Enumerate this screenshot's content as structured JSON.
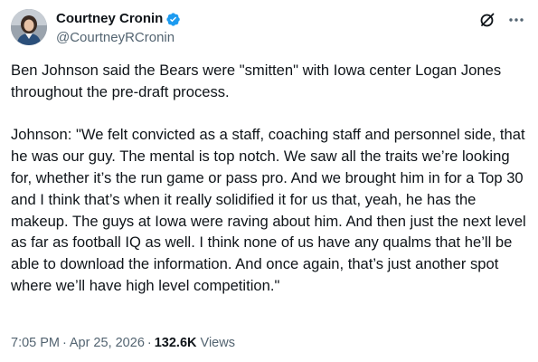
{
  "author": {
    "display_name": "Courtney Cronin",
    "handle": "@CourtneyRCronin",
    "verified": true,
    "verified_badge_color": "#1d9bf0",
    "avatar_icon": "profile-photo"
  },
  "header_actions": {
    "grok_icon": "slashed-circle-icon",
    "more_icon": "more-dots-icon"
  },
  "post": {
    "paragraphs": [
      "Ben Johnson said the Bears were \"smitten\" with Iowa center Logan Jones throughout the pre-draft process.",
      "Johnson: \"We felt convicted as a staff, coaching staff and personnel side, that he was our guy. The mental is top notch. We saw all the traits we’re looking for, whether it’s the run game or pass pro. And we brought him in for a Top 30 and I think that’s when it really solidified it for us that, yeah, he has the makeup. The guys at Iowa were raving about him. And then just the next level as far as football IQ as well. I think none of us have any qualms that he’ll be able to download the information. And once again, that’s just another spot where we’ll have high level competition.\""
    ]
  },
  "meta": {
    "time": "7:05 PM",
    "date": "Apr 25, 2026",
    "separator": "·",
    "views_count": "132.6K",
    "views_label": "Views"
  },
  "colors": {
    "text_primary": "#0f1419",
    "text_secondary": "#536471",
    "background": "#ffffff"
  }
}
